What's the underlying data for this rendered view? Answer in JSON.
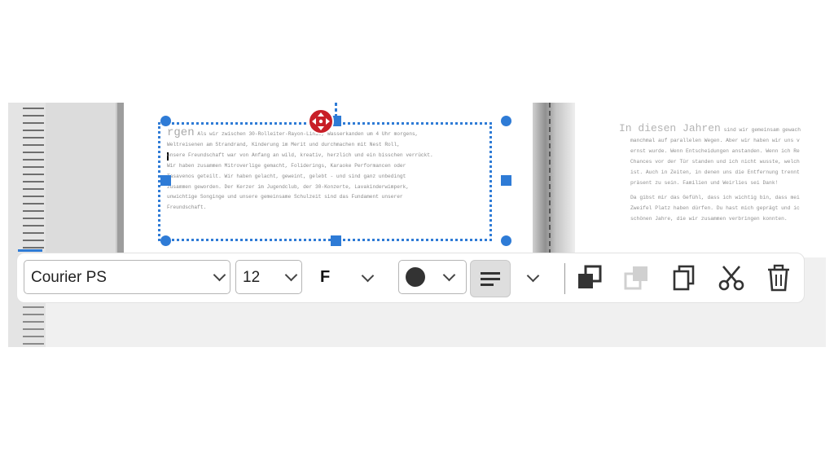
{
  "document": {
    "box_heading": "rgen",
    "box_lines": [
      "Als wir zwischen 30-Rolleiter-Rayon-Linie, Wasserkanden um 4 Uhr morgens,",
      "Weltreisenen am Strandrand, Kinderung im Merit und durchmachen mit Nest Roll,",
      "unsere Freundschaft war von Anfang an wild, kreativ, herzlich und ein bisschen verrückt.",
      "Wir haben zusammen Mitroverlige gemacht, Foliderings, Karaoke Performancen oder",
      "Tasavenos geteilt. Wir haben gelacht, geweint, gelebt - und sind ganz unbedingt",
      "zusammen geworden. Der Kerzer im Jugendclub, der 30-Konzerte, Lavakinderwimperk,",
      "unwichtige Songinge und unsere gemeinsame Schulzeit sind das Fundament unserer",
      "Freundschaft."
    ],
    "page2_heading": "In diesen Jahren",
    "page2_heading_rest": "sind wir gemeinsam gewach",
    "page2_para1": [
      "manchmal auf parallelen Wegen. Aber wir haben wir uns v",
      "ernst wurde. Wenn Entscheidungen anstanden. Wenn ich Re",
      "Chances vor der Tür standen und ich nicht wusste, welch",
      "ist. Auch in Zeiten, in denen uns die Entfernung trennt",
      "präsent zu sein. Familien und Weirlies sei Dank!"
    ],
    "page2_para2": [
      "Da gibst mir das Gefühl, dass ich wichtig bin, dass mei",
      "Zweifel Platz haben dürfen. Du hast mich geprägt und ic",
      "schönen Jahre, die wir zusammen verbringen konnten."
    ]
  },
  "toolbar": {
    "font_family": "Courier PS",
    "font_size": "12",
    "bold_label": "F",
    "text_color": "#333333",
    "align": "align-left-icon"
  },
  "colors": {
    "selection": "#2e7bd6",
    "move_handle": "#c81f28"
  }
}
